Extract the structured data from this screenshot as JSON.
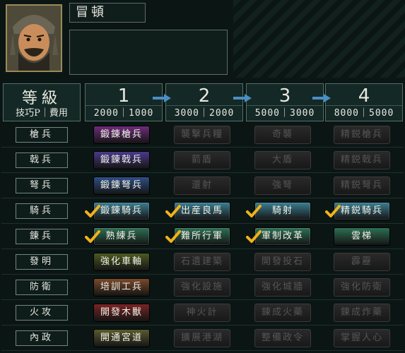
{
  "officer": {
    "name": "冒頓"
  },
  "header": {
    "level_title": "等級",
    "cost_label": "技巧P｜費用"
  },
  "tiers": [
    {
      "num": "1",
      "costs": "2000｜1000"
    },
    {
      "num": "2",
      "costs": "3000｜2000"
    },
    {
      "num": "3",
      "costs": "5000｜3000"
    },
    {
      "num": "4",
      "costs": "8000｜5000"
    }
  ],
  "rows": [
    {
      "label": "槍兵",
      "cells": [
        "鍛錬槍兵",
        "襲撃兵糧",
        "奇襲",
        "精鋭槍兵"
      ],
      "states": [
        "on",
        "off",
        "off",
        "off"
      ],
      "checked": [
        false,
        false,
        false,
        false
      ],
      "color": "#6e2c7a"
    },
    {
      "label": "戟兵",
      "cells": [
        "鍛錬戟兵",
        "箭盾",
        "大盾",
        "精鋭戟兵"
      ],
      "states": [
        "on",
        "off",
        "off",
        "off"
      ],
      "checked": [
        false,
        false,
        false,
        false
      ],
      "color": "#4a3a8a"
    },
    {
      "label": "弩兵",
      "cells": [
        "鍛錬弩兵",
        "還射",
        "強弩",
        "精鋭弩兵"
      ],
      "states": [
        "on",
        "off",
        "off",
        "off"
      ],
      "checked": [
        false,
        false,
        false,
        false
      ],
      "color": "#2f4f86"
    },
    {
      "label": "騎兵",
      "cells": [
        "鍛錬騎兵",
        "出産良馬",
        "騎射",
        "精鋭騎兵"
      ],
      "states": [
        "done",
        "done",
        "done",
        "done"
      ],
      "checked": [
        true,
        true,
        true,
        true
      ],
      "color": "#3b7e92"
    },
    {
      "label": "錬兵",
      "cells": [
        "熟練兵",
        "難所行軍",
        "軍制改革",
        "雲梯"
      ],
      "states": [
        "done",
        "done",
        "done",
        "on"
      ],
      "checked": [
        true,
        true,
        true,
        false
      ],
      "color": "#2e6f54"
    },
    {
      "label": "發明",
      "cells": [
        "強化車軸",
        "石遺建築",
        "開發投石",
        "霹靂"
      ],
      "states": [
        "on",
        "off",
        "off",
        "off"
      ],
      "checked": [
        false,
        false,
        false,
        false
      ],
      "color": "#4a5a22"
    },
    {
      "label": "防衛",
      "cells": [
        "培訓工兵",
        "強化設施",
        "強化城牆",
        "強化防衛"
      ],
      "states": [
        "on",
        "off",
        "off",
        "off"
      ],
      "checked": [
        false,
        false,
        false,
        false
      ],
      "color": "#7a4a2a"
    },
    {
      "label": "火攻",
      "cells": [
        "開發木獸",
        "神火計",
        "錬成火藥",
        "錬成炸藥"
      ],
      "states": [
        "on",
        "off",
        "off",
        "off"
      ],
      "checked": [
        false,
        false,
        false,
        false
      ],
      "color": "#7a2424"
    },
    {
      "label": "內政",
      "cells": [
        "開通宮道",
        "擴展港湖",
        "整備政令",
        "掌握人心"
      ],
      "states": [
        "on",
        "off",
        "off",
        "off"
      ],
      "checked": [
        false,
        false,
        false,
        false
      ],
      "color": "#5a5a30"
    }
  ]
}
